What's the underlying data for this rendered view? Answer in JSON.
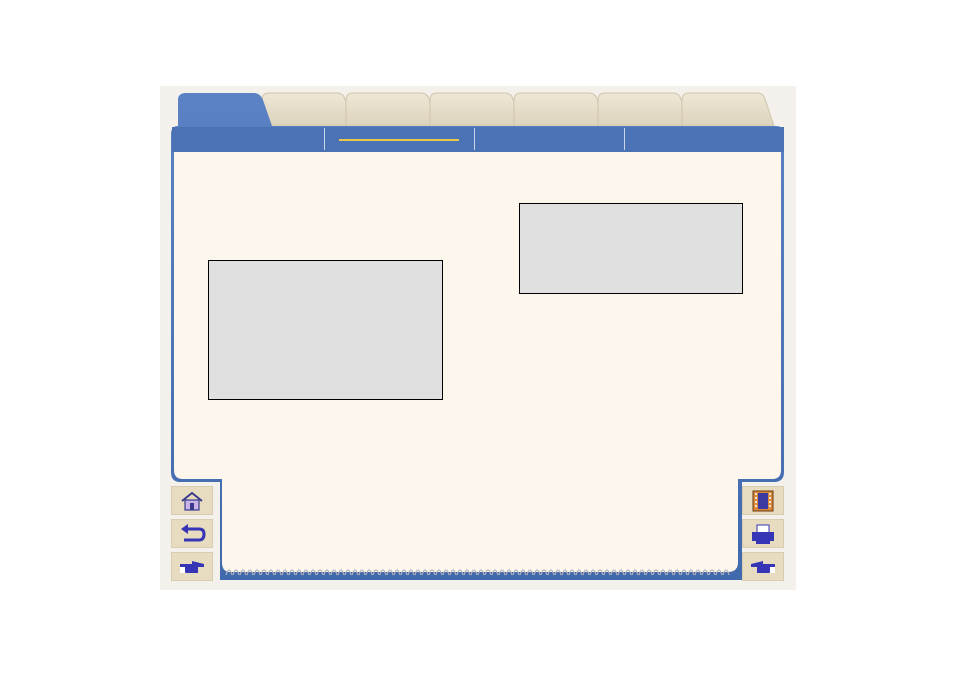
{
  "colors": {
    "frame_blue": "#4a72b5",
    "page_bg": "#fdf6ec",
    "tab_inactive": "#e7dfcb",
    "box_fill": "#e0e0e0",
    "button_bg": "#e7dcc0",
    "accent_underline": "#e8c84a"
  },
  "tabs": [
    {
      "label": "",
      "active": true
    },
    {
      "label": "",
      "active": false
    },
    {
      "label": "",
      "active": false
    },
    {
      "label": "",
      "active": false
    },
    {
      "label": "",
      "active": false
    },
    {
      "label": "",
      "active": false
    },
    {
      "label": "",
      "active": false
    }
  ],
  "subnav": [
    {
      "label": "",
      "active": false
    },
    {
      "label": "",
      "active": true
    },
    {
      "label": "",
      "active": false
    },
    {
      "label": "",
      "active": false
    }
  ],
  "nav_buttons_left": [
    "home-icon",
    "back-arrow-icon",
    "next-hand-icon"
  ],
  "nav_buttons_right": [
    "contents-book-icon",
    "printer-icon",
    "previous-hand-icon"
  ]
}
